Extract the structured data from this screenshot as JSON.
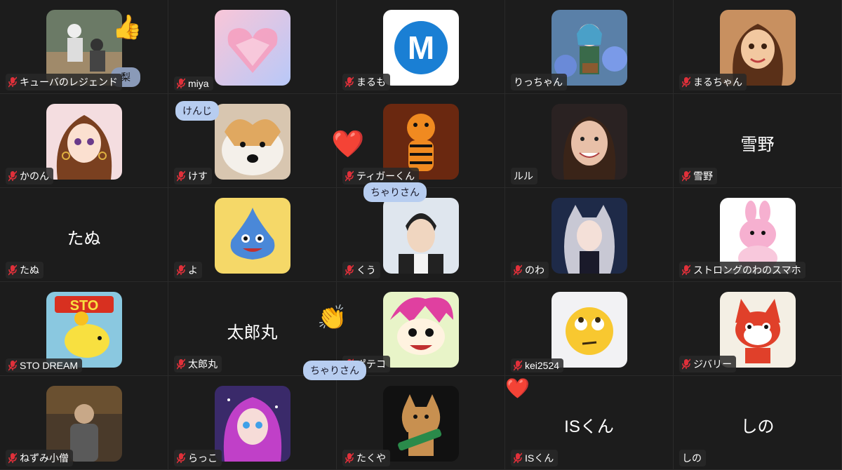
{
  "participants": [
    {
      "name": "キューバのレジェンド",
      "muted": true,
      "avatar": "baseball-photo",
      "bg": "#7a8a70"
    },
    {
      "name": "miya",
      "muted": true,
      "avatar": "crystal-heart",
      "bg": "#f0b8c8"
    },
    {
      "name": "まるも",
      "muted": true,
      "avatar": "letter-m-logo",
      "bg": "#ffffff"
    },
    {
      "name": "りっちゃん",
      "muted": false,
      "avatar": "anime-girl-hydrangea",
      "bg": "#6a8ab0"
    },
    {
      "name": "まるちゃん",
      "muted": true,
      "avatar": "anime-girl-brown-hair",
      "bg": "#c89060"
    },
    {
      "name": "かのん",
      "muted": true,
      "avatar": "anime-girl-earrings",
      "bg": "#f4dde0"
    },
    {
      "name": "けす",
      "muted": true,
      "avatar": "shiba-dog",
      "bg": "#d8c6b0"
    },
    {
      "name": "ティガーくん",
      "muted": true,
      "avatar": "tigger",
      "bg": "#7a3010"
    },
    {
      "name": "ルル",
      "muted": false,
      "avatar": "woman-smiling-photo",
      "bg": "#3a3030"
    },
    {
      "name": "雪野",
      "muted": true,
      "avatar": "",
      "bg": ""
    },
    {
      "name": "たぬ",
      "muted": true,
      "avatar": "",
      "bg": ""
    },
    {
      "name": "よ",
      "muted": true,
      "avatar": "slime",
      "bg": "#f5d868"
    },
    {
      "name": "くう",
      "muted": true,
      "avatar": "anime-boy",
      "bg": "#dfe6ee"
    },
    {
      "name": "のわ",
      "muted": true,
      "avatar": "anime-girl-cat-ears",
      "bg": "#2a3a5a"
    },
    {
      "name": "ストロングのわのスマホ",
      "muted": true,
      "avatar": "pink-rabbit",
      "bg": "#ffffff"
    },
    {
      "name": "STO DREAM",
      "muted": true,
      "avatar": "sto-piggy",
      "bg": "#9ad0e8"
    },
    {
      "name": "太郎丸",
      "muted": true,
      "avatar": "",
      "bg": ""
    },
    {
      "name": "ポテコ",
      "muted": true,
      "avatar": "manga-character",
      "bg": "#e8f4c8"
    },
    {
      "name": "kei2524",
      "muted": true,
      "avatar": "eye-roll-emoji",
      "bg": "#f2f2f4"
    },
    {
      "name": "ジバリー",
      "muted": true,
      "avatar": "red-cat-yokai",
      "bg": "#f4efe4"
    },
    {
      "name": "ねずみ小僧",
      "muted": true,
      "avatar": "man-in-kitchen-photo",
      "bg": "#4a3a2a"
    },
    {
      "name": "らっこ",
      "muted": true,
      "avatar": "anime-girl-cosmic",
      "bg": "#3a2a6a"
    },
    {
      "name": "たくや",
      "muted": true,
      "avatar": "dog-with-guitar",
      "bg": "#111111"
    },
    {
      "name": "ISくん",
      "muted": true,
      "avatar": "",
      "bg": ""
    },
    {
      "name": "しの",
      "muted": false,
      "avatar": "",
      "bg": ""
    }
  ],
  "big_names": {
    "t9": "雪野",
    "t10": "たぬ",
    "t16": "太郎丸",
    "t23": "ISくん",
    "t24": "しの"
  },
  "overlays": {
    "bubble_nashi": "梨",
    "bubble_kenji": "けんじ",
    "bubble_chari_1": "ちゃりさん",
    "bubble_chari_2": "ちゃりさん",
    "sto_text": "STO",
    "m_letter": "M"
  },
  "colors": {
    "background": "#1c1c1c",
    "muted_icon": "#e0303a",
    "bubble": "#b7cdf0",
    "m_logo": "#1a7fd4"
  },
  "icons": {
    "mic_muted": "mic-muted-icon",
    "thumbs_up": "thumbs-up-emoji",
    "heart": "heart-emoji",
    "clap": "clapping-hands-emoji"
  }
}
